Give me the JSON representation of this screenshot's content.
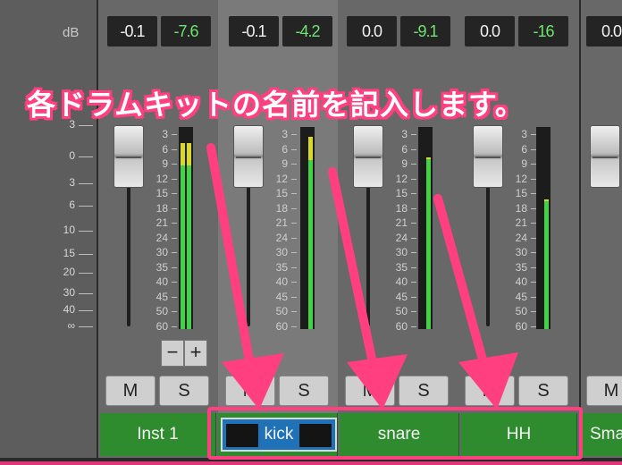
{
  "scale_label": "dB",
  "main_scale": [
    "3",
    "0",
    "3",
    "6",
    "10",
    "15",
    "20",
    "30",
    "40",
    "∞"
  ],
  "meter_scale": [
    "3",
    "6",
    "9",
    "12",
    "15",
    "18",
    "21",
    "24",
    "30",
    "35",
    "40",
    "45",
    "50",
    "60"
  ],
  "strips": [
    {
      "volume": "-0.1",
      "peak": "-7.6",
      "mute": "M",
      "solo": "S",
      "name": "Inst 1",
      "meter_level": [
        0.92,
        0.92
      ],
      "meter_clip": true
    },
    {
      "volume": "-0.1",
      "peak": "-4.2",
      "mute": "M",
      "solo": "S",
      "name": "kick",
      "meter_level": [
        0,
        0.95
      ],
      "meter_clip": true,
      "selected": true,
      "editing": true
    },
    {
      "volume": "0.0",
      "peak": "-9.1",
      "mute": "M",
      "solo": "S",
      "name": "snare",
      "meter_level": [
        0,
        0.85
      ],
      "meter_clip": false
    },
    {
      "volume": "0.0",
      "peak": "-16",
      "mute": "M",
      "solo": "S",
      "name": "HH",
      "meter_level": [
        0,
        0.64
      ],
      "meter_clip": false
    },
    {
      "volume": "0.0",
      "peak": "",
      "mute": "M",
      "solo": "",
      "name": "Sma"
    }
  ],
  "group_buttons": {
    "minus": "−",
    "plus": "+"
  },
  "annotation": {
    "text": "各ドラムキットの名前を記入します。",
    "color": "#ff3f7f"
  },
  "colors": {
    "name_bar": "#2e8b2e",
    "meter_green": "#45d145",
    "meter_yellow": "#d8d82a",
    "edit_field": "#1f72b8"
  }
}
